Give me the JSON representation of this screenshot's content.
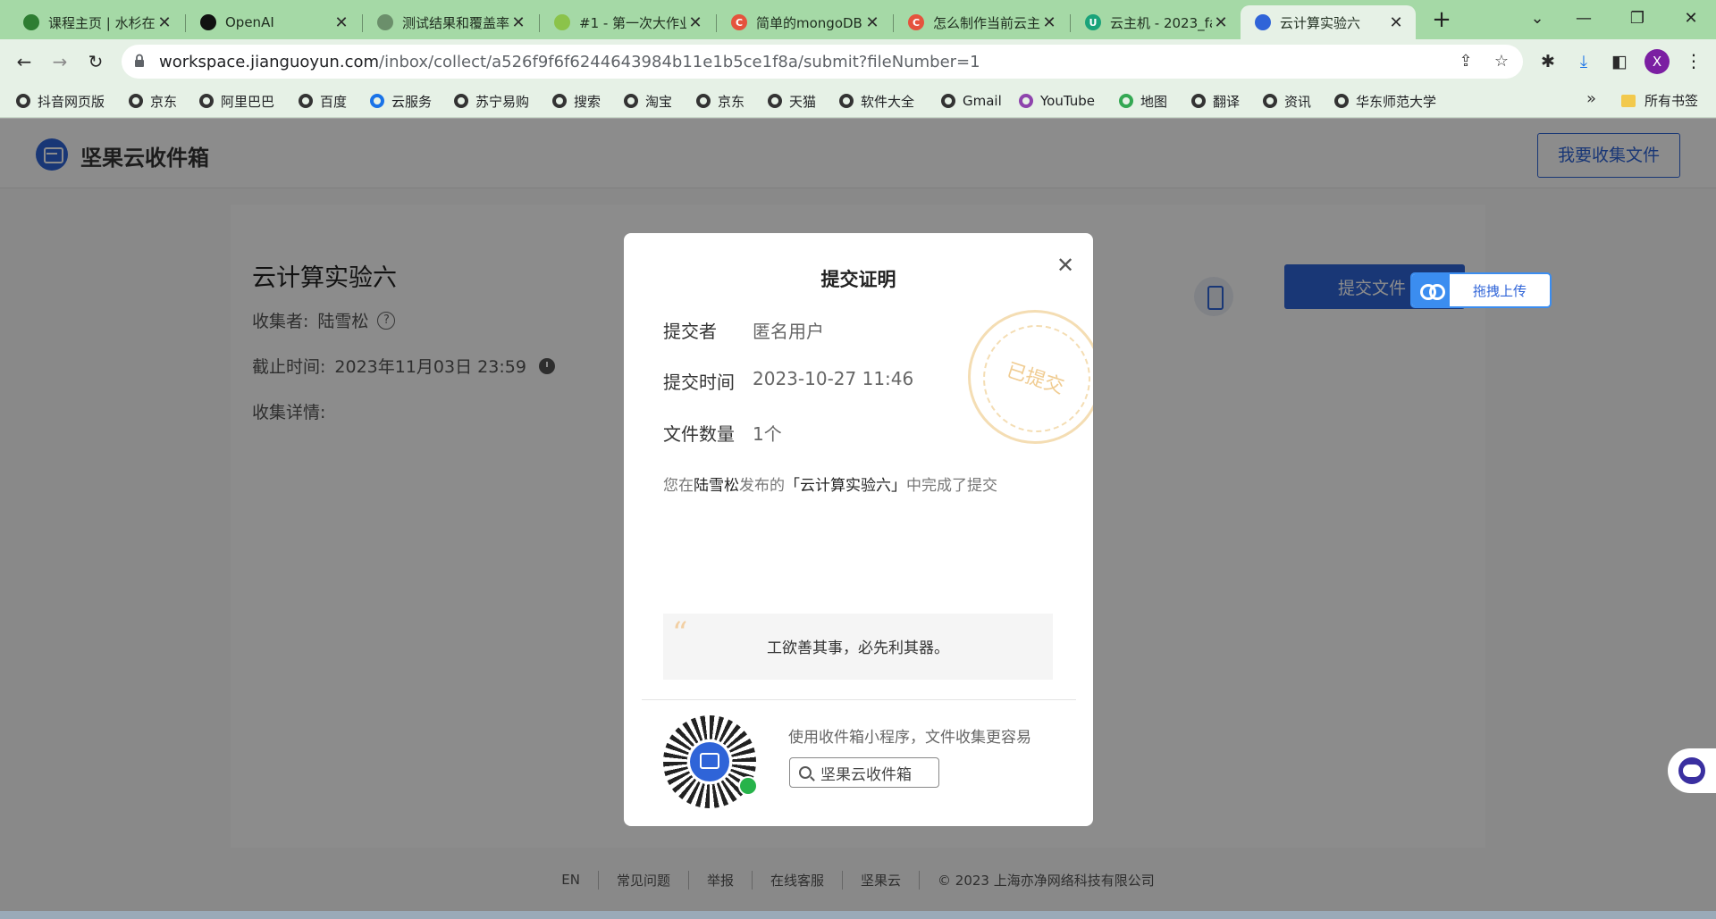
{
  "browser": {
    "tabs": [
      {
        "label": "课程主页 | 水杉在",
        "favicon_color": "#2e7d32"
      },
      {
        "label": "OpenAI",
        "favicon_color": "#111111"
      },
      {
        "label": "测试结果和覆盖率",
        "favicon_color": "#6b8f6b"
      },
      {
        "label": "#1 - 第一次大作业",
        "favicon_color": "#8bc34a"
      },
      {
        "label": "简单的mongoDB",
        "favicon_color": "#e5533d"
      },
      {
        "label": "怎么制作当前云主",
        "favicon_color": "#e5533d"
      },
      {
        "label": "云主机 - 2023_fa",
        "favicon_color": "#1aa37a"
      },
      {
        "label": "云计算实验六",
        "favicon_color": "#2f64d8"
      }
    ],
    "url_host": "workspace.jianguoyun.com",
    "url_path": "/inbox/collect/a526f9f6f6244643984b11e1b5ce1f8a/submit?fileNumber=1",
    "profile_initial": "X",
    "bookmarks": [
      "抖音网页版",
      "京东",
      "阿里巴巴",
      "百度",
      "云服务",
      "苏宁易购",
      "搜索",
      "淘宝",
      "京东",
      "天猫",
      "软件大全",
      "Gmail",
      "YouTube",
      "地图",
      "翻译",
      "资讯",
      "华东师范大学"
    ],
    "bookmarks_more": "»",
    "all_bookmarks": "所有书签"
  },
  "header": {
    "brand": "坚果云收件箱",
    "collect_button": "我要收集文件"
  },
  "task": {
    "title": "云计算实验六",
    "collector_label": "收集者:",
    "collector": "陆雪松",
    "deadline_label": "截止时间:",
    "deadline": "2023年11月03日 23:59",
    "detail_label": "收集详情:",
    "submit_button": "提交文件",
    "drag_upload": "拖拽上传"
  },
  "modal": {
    "title": "提交证明",
    "submitter_label": "提交者",
    "submitter": "匿名用户",
    "time_label": "提交时间",
    "time": "2023-10-27 11:46",
    "count_label": "文件数量",
    "count": "1个",
    "stamp_text": "已提交",
    "done_prefix": "您在",
    "done_person": "陆雪松",
    "done_mid": "发布的",
    "done_task": "「云计算实验六」",
    "done_suffix": "中完成了提交",
    "quote": "工欲善其事，必先利其器。",
    "mini_desc": "使用收件箱小程序，文件收集更容易",
    "mini_search": "坚果云收件箱"
  },
  "footer": [
    "EN",
    "常见问题",
    "举报",
    "在线客服",
    "坚果云",
    "© 2023 上海亦净网络科技有限公司"
  ]
}
